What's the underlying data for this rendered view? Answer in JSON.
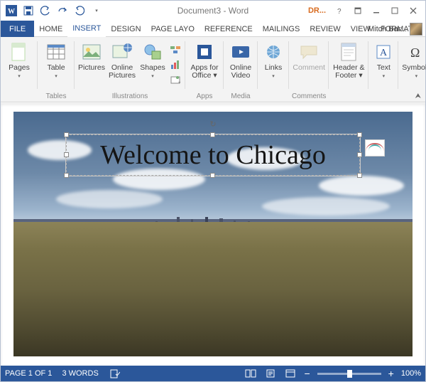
{
  "title": "Document3 - Word",
  "design_badge": "DR...",
  "user_name": "Mitch Bar...",
  "menu": {
    "file": "FILE",
    "tabs": [
      "HOME",
      "INSERT",
      "DESIGN",
      "PAGE LAYO",
      "REFERENCE",
      "MAILINGS",
      "REVIEW",
      "VIEW",
      "FORMAT"
    ],
    "active": "INSERT"
  },
  "ribbon": {
    "groups": [
      {
        "label": "",
        "items": [
          {
            "name": "pages",
            "label": "Pages"
          }
        ]
      },
      {
        "label": "Tables",
        "items": [
          {
            "name": "table",
            "label": "Table"
          }
        ]
      },
      {
        "label": "Illustrations",
        "items": [
          {
            "name": "pictures",
            "label": "Pictures"
          },
          {
            "name": "online-pictures",
            "label": "Online Pictures"
          },
          {
            "name": "shapes",
            "label": "Shapes"
          }
        ]
      },
      {
        "label": "Apps",
        "items": [
          {
            "name": "apps-for-office",
            "label": "Apps for Office ▾"
          }
        ]
      },
      {
        "label": "Media",
        "items": [
          {
            "name": "online-video",
            "label": "Online Video"
          }
        ]
      },
      {
        "label": "",
        "items": [
          {
            "name": "links",
            "label": "Links"
          }
        ]
      },
      {
        "label": "Comments",
        "items": [
          {
            "name": "comment",
            "label": "Comment",
            "disabled": true
          }
        ]
      },
      {
        "label": "",
        "items": [
          {
            "name": "header-footer",
            "label": "Header & Footer ▾"
          }
        ]
      },
      {
        "label": "",
        "items": [
          {
            "name": "text",
            "label": "Text"
          }
        ]
      },
      {
        "label": "",
        "items": [
          {
            "name": "symbols",
            "label": "Symbols"
          }
        ]
      }
    ]
  },
  "document": {
    "textbox_content": "Welcome to Chicago"
  },
  "status": {
    "page": "PAGE 1 OF 1",
    "words": "3 WORDS",
    "zoom": "100%"
  }
}
